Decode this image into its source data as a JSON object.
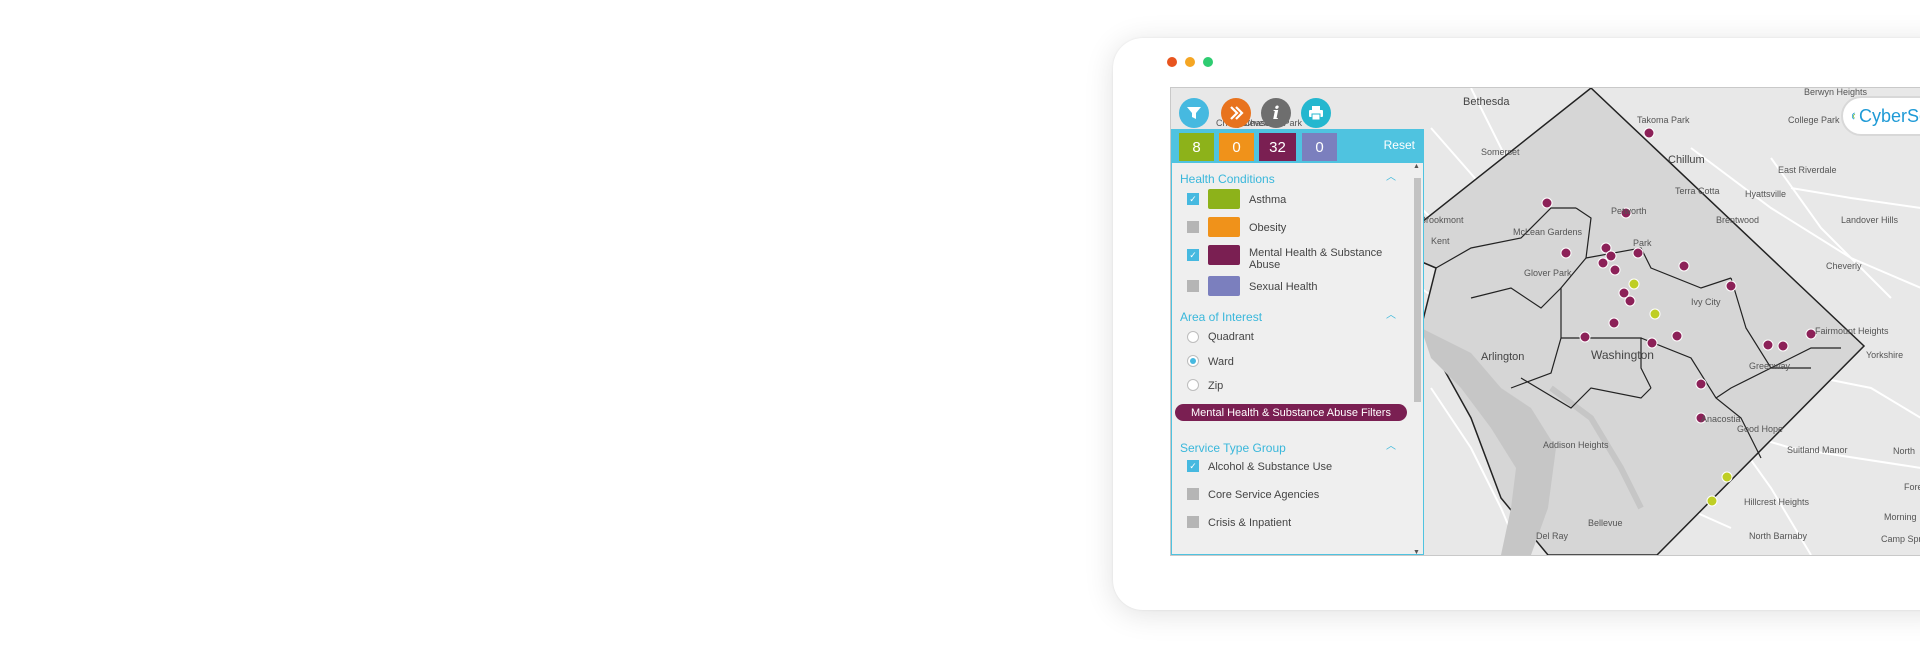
{
  "window": {
    "dot_colors": [
      "#e8541e",
      "#f5a623",
      "#2ecc71"
    ]
  },
  "toolbar": {
    "icons": [
      {
        "name": "filter-icon",
        "color": "#46b9e0"
      },
      {
        "name": "share-icon",
        "color": "#e8731e"
      },
      {
        "name": "info-icon",
        "color": "#6e6e6e"
      },
      {
        "name": "print-icon",
        "color": "#24b7cf"
      }
    ]
  },
  "logo": {
    "text": "CyberSe"
  },
  "counters": {
    "asthma": {
      "value": "8",
      "color": "#8db21a"
    },
    "obesity": {
      "value": "0",
      "color": "#f0921a"
    },
    "mental_health": {
      "value": "32",
      "color": "#7a1f52"
    },
    "sexual_health": {
      "value": "0",
      "color": "#7b7fbe"
    },
    "reset_label": "Reset"
  },
  "health_conditions": {
    "title": "Health Conditions",
    "items": [
      {
        "label": "Asthma",
        "checked": true,
        "color": "#8db21a"
      },
      {
        "label": "Obesity",
        "checked": false,
        "color": "#f0921a"
      },
      {
        "label": "Mental Health & Substance",
        "label2": "Abuse",
        "checked": true,
        "color": "#7a1f52"
      },
      {
        "label": "Sexual Health",
        "checked": false,
        "color": "#7b7fbe"
      }
    ]
  },
  "area_of_interest": {
    "title": "Area of Interest",
    "options": [
      {
        "label": "Quadrant",
        "selected": false
      },
      {
        "label": "Ward",
        "selected": true
      },
      {
        "label": "Zip",
        "selected": false
      }
    ]
  },
  "filters_button": {
    "label": "Mental Health & Substance Abuse Filters"
  },
  "service_type_group": {
    "title": "Service Type Group",
    "items": [
      {
        "label": "Alcohol & Substance Use",
        "checked": true
      },
      {
        "label": "Core Service Agencies",
        "checked": false
      },
      {
        "label": "Crisis & Inpatient",
        "checked": false
      }
    ]
  },
  "map": {
    "labels": [
      "Bethesda",
      "Takoma Park",
      "Berwyn Heights",
      "College Park",
      "Somerset",
      "Chillum",
      "East Riverdale",
      "Hyattsville",
      "Terra Cotta",
      "Brentwood",
      "Landover Hills",
      "Cheverly",
      "McLean Gardens",
      "Kent",
      "Glover Park",
      "Petworth",
      "Ivy City",
      "Arlington",
      "Washington",
      "Greenway",
      "Fairmount Heights",
      "Yorkshire",
      "Addison Heights",
      "Good Hope",
      "Suitland Manor",
      "Anacostia",
      "Hillcrest Heights",
      "Bellevue",
      "Del Ray",
      "North Barnaby",
      "Camp Spri",
      "Cleveland Park",
      "Chevy Chase",
      "Brookmont",
      "Morning",
      "North",
      "Fores",
      "Park"
    ],
    "land_color": "#e8e8e8",
    "dc_color": "#d6d6d6",
    "river_color": "#c6c6c6",
    "marker_colors": {
      "mental_health": "#8c2158",
      "asthma": "#bfce24"
    }
  }
}
